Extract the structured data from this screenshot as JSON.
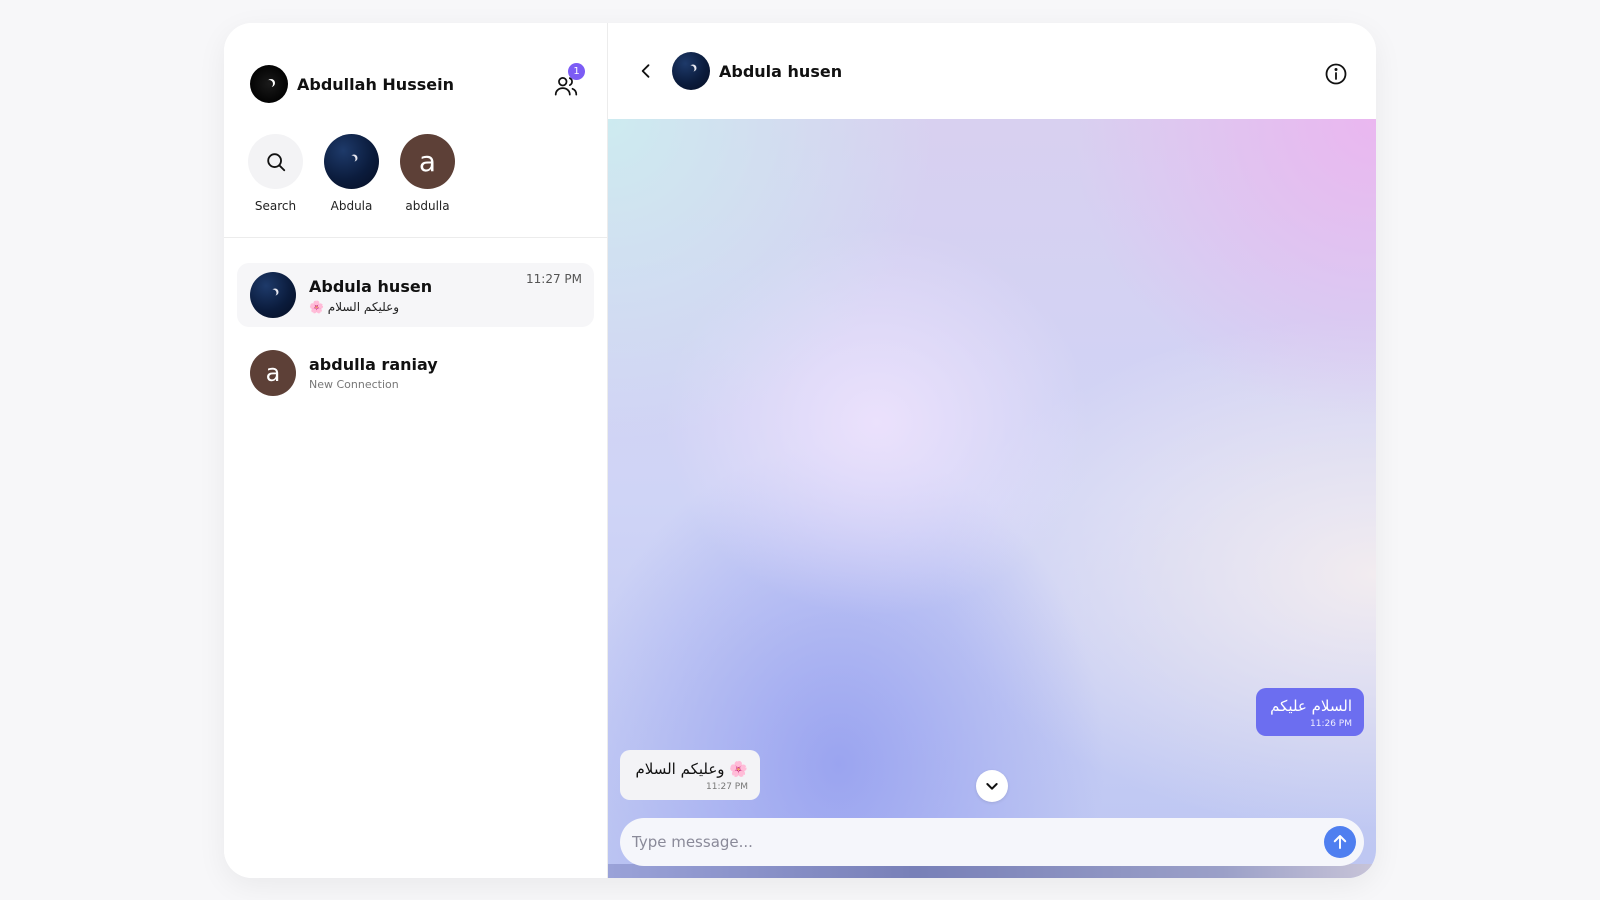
{
  "user": {
    "name": "Abdullah Hussein"
  },
  "header": {
    "contacts_badge": "1"
  },
  "stories": [
    {
      "label": "Search",
      "icon": "search-icon"
    },
    {
      "label": "Abdula",
      "avatar": "night-moon"
    },
    {
      "label": "abdulla",
      "avatar_letter": "a"
    }
  ],
  "conversations": [
    {
      "name": "Abdula husen",
      "preview": "🌸 وعليكم السلام",
      "time": "11:27 PM",
      "active": true
    },
    {
      "name": "abdulla raniay",
      "preview": "New Connection",
      "avatar_letter": "a"
    }
  ],
  "chat": {
    "title": "Abdula husen",
    "messages": [
      {
        "direction": "outgoing",
        "text": "السلام عليكم",
        "time": "11:26 PM"
      },
      {
        "direction": "incoming",
        "text": "🌸 وعليكم السلام",
        "time": "11:27 PM"
      }
    ],
    "composer": {
      "placeholder": "Type message..."
    }
  },
  "colors": {
    "accent": "#7c5cf5",
    "outgoing_bubble": "#6c6ef0",
    "send_button": "#4f7ff0",
    "letter_avatar": "#5d4037"
  }
}
